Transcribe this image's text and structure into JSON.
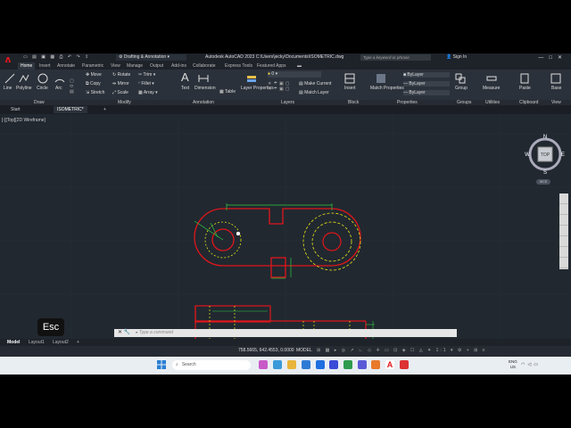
{
  "titlebar": {
    "workspace": "Drafting & Annotation",
    "app_title": "Autodesk AutoCAD 2023  C:\\Users\\jecky\\Documents\\ISOMETRIC.dwg",
    "search_placeholder": "Type a keyword or phrase",
    "sign_in": "Sign In"
  },
  "ribbon_tabs": [
    "Home",
    "Insert",
    "Annotate",
    "Parametric",
    "View",
    "Manage",
    "Output",
    "Add-ins",
    "Collaborate",
    "Express Tools",
    "Featured Apps"
  ],
  "draw": {
    "line": "Line",
    "polyline": "Polyline",
    "circle": "Circle",
    "arc": "Arc"
  },
  "modify": {
    "move": "Move",
    "rotate": "Rotate",
    "trim": "Trim",
    "copy": "Copy",
    "mirror": "Mirror",
    "fillet": "Fillet",
    "stretch": "Stretch",
    "scale": "Scale",
    "array": "Array"
  },
  "annotation": {
    "text": "Text",
    "dimension": "Dimension",
    "table": "Table"
  },
  "layers": {
    "layer_properties": "Layer Properties",
    "current_layer": "0",
    "make_current": "Make Current",
    "match_layer": "Match Layer"
  },
  "block": {
    "insert": "Insert"
  },
  "properties": {
    "match_properties": "Match Properties",
    "bylayer": "ByLayer"
  },
  "groups": {
    "group": "Group"
  },
  "utilities": {
    "measure": "Measure"
  },
  "clipboard": {
    "paste": "Paste"
  },
  "view": {
    "base": "Base"
  },
  "panel_labels": [
    "Draw",
    "Modify",
    "Annotation",
    "Layers",
    "Block",
    "Properties",
    "Groups",
    "Utilities",
    "Clipboard",
    "View"
  ],
  "doc_tabs": {
    "start": "Start",
    "current": "ISOMETRIC*"
  },
  "viewport": {
    "label": "[-][Top][2D Wireframe]"
  },
  "viewcube": {
    "top": "TOP",
    "n": "N",
    "s": "S",
    "w": "W",
    "e": "E",
    "wcs": "WCS"
  },
  "command": {
    "placeholder": "Type a command"
  },
  "overlay": {
    "key": "Esc"
  },
  "layout_tabs": [
    "Model",
    "Layout1",
    "Layout2"
  ],
  "status": {
    "coords": "758.5665, 642.4553, 0.0000",
    "model": "MODEL",
    "scale": "1:1"
  },
  "taskbar": {
    "search": "Search",
    "lang_top": "ENG",
    "lang_bottom": "US"
  },
  "colors": {
    "red": "#e0161b",
    "green": "#2ecc40",
    "yellow": "#e8e817",
    "bg": "#212830"
  }
}
